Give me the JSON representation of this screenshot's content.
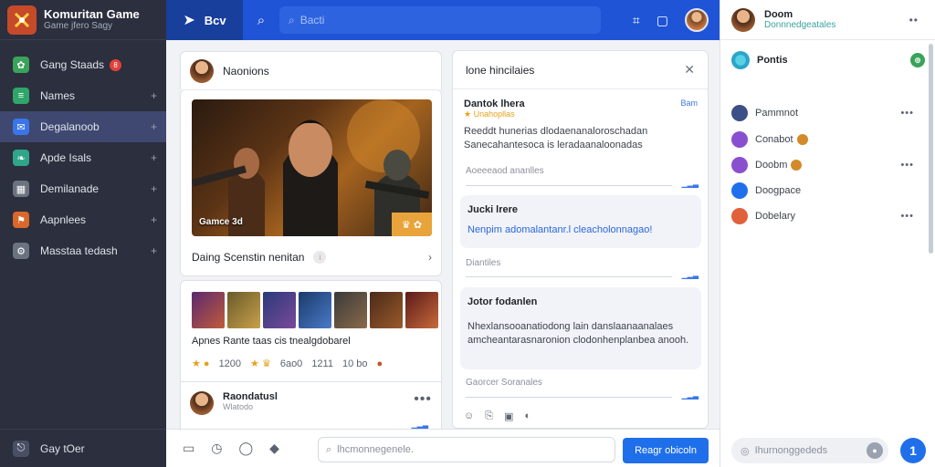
{
  "brand": {
    "title": "Komuritan Game",
    "subtitle": "Game jfero Sagy"
  },
  "sidebar": {
    "items": [
      {
        "label": "Gang Staads",
        "badge": "8",
        "icon": "game-icon",
        "color": "#3aa35a"
      },
      {
        "label": "Names",
        "icon": "list-icon",
        "color": "#2fa56a"
      },
      {
        "label": "Degalanoob",
        "icon": "chat-icon",
        "color": "#3a76ea",
        "active": true
      },
      {
        "label": "Apde Isals",
        "icon": "leaf-icon",
        "color": "#2fa58a"
      },
      {
        "label": "Demilanade",
        "icon": "grid-icon",
        "color": "#6b7280"
      },
      {
        "label": "Aapnlees",
        "icon": "flag-icon",
        "color": "#d9682a"
      },
      {
        "label": "Masstaa tedash",
        "icon": "gear-icon",
        "color": "#6b7280"
      }
    ],
    "footer": "Gay tOer"
  },
  "topbar": {
    "home_label": "Bcv",
    "search_placeholder": "Bacti"
  },
  "feed": {
    "header_title": "Naonions",
    "hero_caption": "Gamce 3d",
    "hero_badge": "♛ ✿",
    "row_label": "Daing Scenstin nenitan",
    "gallery_title": "Apnes Rante taas cis tnealgdobarel",
    "stats": [
      "1200",
      "6ao0",
      "1211",
      "10 bo"
    ],
    "post_title": "Raondatusl",
    "post_sub": "Wlatodo"
  },
  "thread": {
    "title": "lone hincilaies",
    "msg1": {
      "name": "Dantok lhera",
      "tag": "Bam",
      "stars": "★ Unahopllas",
      "body": "Reeddt hunerias dlodaenanaloroschadan Sanecahantesoca is leradaanaloonadas",
      "meta": "Aoeeeaod ananlles"
    },
    "bubble1": {
      "name": "Jucki lrere",
      "link": "Nenpim adomalantanr.l cleacholonnagao!"
    },
    "meta2": "Diantiles",
    "bubble2": {
      "name": "Jotor fodanlen",
      "body": "Nhexlansooanatiodong lain danslaanaanalaes amcheantarasnaronion clodonhenplanbea anooh."
    },
    "meta3": "Gaorcer Soranales"
  },
  "composer": {
    "placeholder": "lhcmonnegenele.",
    "send_label": "Reagr obicoln"
  },
  "right": {
    "user_name": "Doom",
    "user_status": "Donnnedgeatales",
    "section": "Pontis",
    "items": [
      {
        "label": "Pammnot",
        "color": "#3c4f86",
        "emoji": false,
        "more": true
      },
      {
        "label": "Conabot",
        "color": "#8a4fcf",
        "emoji": true,
        "more": false
      },
      {
        "label": "Doobm",
        "color": "#8a4fcf",
        "emoji": true,
        "more": true
      },
      {
        "label": "Doogpace",
        "color": "#1f6feb",
        "emoji": false,
        "more": false
      },
      {
        "label": "Dobelary",
        "color": "#e0613a",
        "emoji": false,
        "more": true
      }
    ],
    "input_placeholder": "Ihurnonggededs",
    "fab_label": "1"
  }
}
